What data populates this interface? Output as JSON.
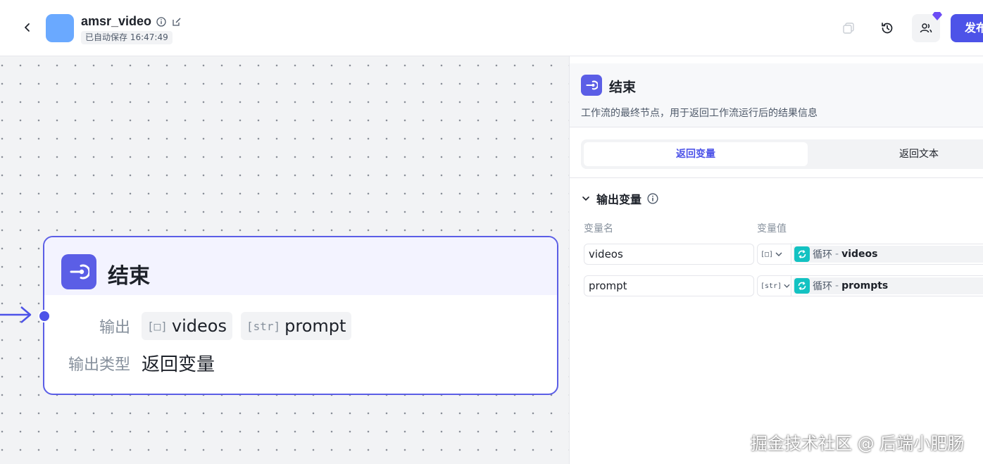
{
  "header": {
    "app_title": "amsr_video",
    "autosave_status": "已自动保存 16:47:49",
    "publish_label": "发布",
    "app_icon_color": "#6aa9ff",
    "accent_color": "#4d53e8"
  },
  "node": {
    "title": "结束",
    "output_label": "输出",
    "outputs": [
      {
        "type": "[□]",
        "name": "videos"
      },
      {
        "type": "[str]",
        "name": "prompt"
      }
    ],
    "output_type_label": "输出类型",
    "output_type_value": "返回变量"
  },
  "panel": {
    "title": "结束",
    "description": "工作流的最终节点，用于返回工作流运行后的结果信息",
    "tabs": [
      {
        "label": "返回变量",
        "active": true
      },
      {
        "label": "返回文本",
        "active": false
      }
    ],
    "section_title": "输出变量",
    "col_name": "变量名",
    "col_value": "变量值",
    "rows": [
      {
        "name": "videos",
        "type": "[□]",
        "source": "循环",
        "sep": "-",
        "ref": "videos"
      },
      {
        "name": "prompt",
        "type": "[str]",
        "source": "循环",
        "sep": "-",
        "ref": "prompts"
      }
    ]
  },
  "watermark": "掘金技术社区 @ 后端小肥肠"
}
